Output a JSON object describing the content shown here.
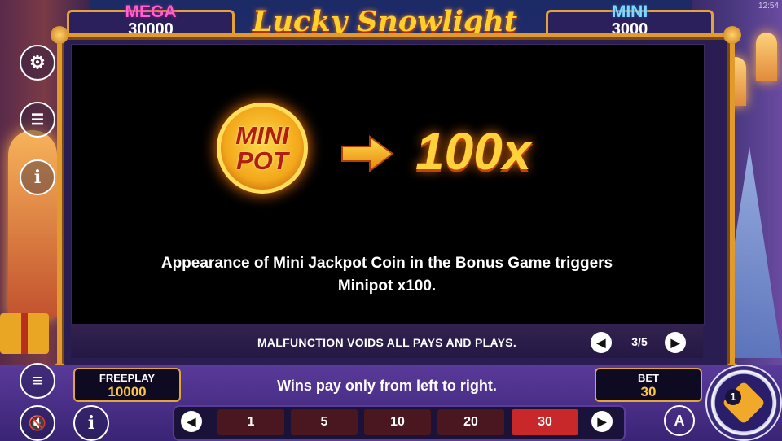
{
  "header": {
    "title": "Lucky Snowlight",
    "clock": "12:54",
    "jackpots": {
      "mega": {
        "label": "MEGA",
        "value": "30000",
        "color": "#ff5fd0"
      },
      "mini": {
        "label": "MINI",
        "value": "3000",
        "color": "#7fd8ff"
      }
    }
  },
  "info_page": {
    "coin_text_line1": "MINI",
    "coin_text_line2": "POT",
    "multiplier": "100x",
    "description_line1": "Appearance of Mini Jackpot Coin in the Bonus Game triggers",
    "description_line2": "Minipot x100.",
    "malfunction_notice": "MALFUNCTION VOIDS ALL PAYS AND PLAYS.",
    "page_indicator": "3/5"
  },
  "side_icons": [
    "gear-icon",
    "coins-stack-icon",
    "info-icon",
    "menu-icon",
    "sound-muted-icon"
  ],
  "footer": {
    "freeplay_label": "FREEPLAY",
    "freeplay_value": "10000",
    "message": "Wins pay only from left to right.",
    "bet_label": "BET",
    "bet_value": "30",
    "bet_options": [
      "1",
      "5",
      "10",
      "20",
      "30"
    ],
    "selected_bet": "30",
    "info_button_icon": "i",
    "autoplay_label": "A",
    "spin_badge": "1"
  },
  "colors": {
    "accent_gold": "#e39a2c",
    "selected_bet": "#c8282a",
    "value_yellow": "#ffc83a"
  }
}
